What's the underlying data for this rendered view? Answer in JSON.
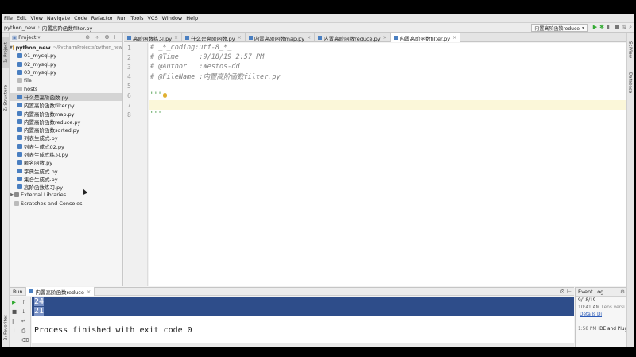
{
  "menu": [
    "File",
    "Edit",
    "View",
    "Navigate",
    "Code",
    "Refactor",
    "Run",
    "Tools",
    "VCS",
    "Window",
    "Help"
  ],
  "breadcrumb": [
    "python_new",
    "内置高阶函数filter.py"
  ],
  "run_config": "内置高阶函数reduce",
  "left_tabs": [
    "1: Project",
    "Z: Structure",
    "2: Favorites"
  ],
  "right_tabs": [
    "SciView",
    "Database"
  ],
  "project": {
    "title": "Project",
    "root": "python_new",
    "root_path": "~/PycharmProjects/python_new",
    "files": [
      {
        "name": "01_mysql.py",
        "type": "py"
      },
      {
        "name": "02_mysql.py",
        "type": "py"
      },
      {
        "name": "03_mysql.py",
        "type": "py"
      },
      {
        "name": "file",
        "type": "txt"
      },
      {
        "name": "hosts",
        "type": "txt"
      },
      {
        "name": "什么是高阶函数.py",
        "type": "py",
        "selected": true
      },
      {
        "name": "内置高阶函数filter.py",
        "type": "py"
      },
      {
        "name": "内置高阶函数map.py",
        "type": "py"
      },
      {
        "name": "内置高阶函数reduce.py",
        "type": "py"
      },
      {
        "name": "内置高阶函数sorted.py",
        "type": "py"
      },
      {
        "name": "列表生成式.py",
        "type": "py"
      },
      {
        "name": "列表生成式02.py",
        "type": "py"
      },
      {
        "name": "列表生成式练习.py",
        "type": "py"
      },
      {
        "name": "匿名函数.py",
        "type": "py"
      },
      {
        "name": "字典生成式.py",
        "type": "py"
      },
      {
        "name": "集合生成式.py",
        "type": "py"
      },
      {
        "name": "高阶函数练习.py",
        "type": "py"
      }
    ],
    "external": "External Libraries",
    "scratches": "Scratches and Consoles"
  },
  "tabs": [
    {
      "label": "高阶函数练习.py",
      "active": false
    },
    {
      "label": "什么是高阶函数.py",
      "active": false
    },
    {
      "label": "内置高阶函数map.py",
      "active": false
    },
    {
      "label": "内置高阶函数reduce.py",
      "active": false
    },
    {
      "label": "内置高阶函数filter.py",
      "active": true
    }
  ],
  "code_lines": [
    {
      "n": "1",
      "text": "# _*_coding:utf-8_*_",
      "kind": "cm"
    },
    {
      "n": "2",
      "text": "# @Time     :9/18/19 2:57 PM",
      "kind": "cm"
    },
    {
      "n": "3",
      "text": "# @Author   :Westos-dd",
      "kind": "cm"
    },
    {
      "n": "4",
      "text": "# @FileName :内置高阶函数filter.py",
      "kind": "cm"
    },
    {
      "n": "5",
      "text": "",
      "kind": ""
    },
    {
      "n": "6",
      "text": "\"\"\"",
      "kind": "str",
      "bulb": true
    },
    {
      "n": "7",
      "text": "",
      "kind": "cur"
    },
    {
      "n": "8",
      "text": "\"\"\"",
      "kind": "str"
    }
  ],
  "run": {
    "label": "Run",
    "tab": "内置高阶函数reduce",
    "output": [
      {
        "text": "24",
        "hl": true
      },
      {
        "text": "21",
        "hl": true
      },
      {
        "text": "",
        "hl": false
      },
      {
        "text": "Process finished with exit code 0",
        "hl": false
      }
    ]
  },
  "event_log": {
    "title": "Event Log",
    "date": "9/18/19",
    "entries": [
      {
        "time": "10:41 AM",
        "text": "Lens versi",
        "style": "gr"
      },
      {
        "time": "",
        "text": "Details Di",
        "style": "lk"
      },
      {
        "time": "",
        "text": "",
        "style": ""
      },
      {
        "time": "1:58 PM",
        "text": "IDE and Plug",
        "style": ""
      }
    ]
  }
}
